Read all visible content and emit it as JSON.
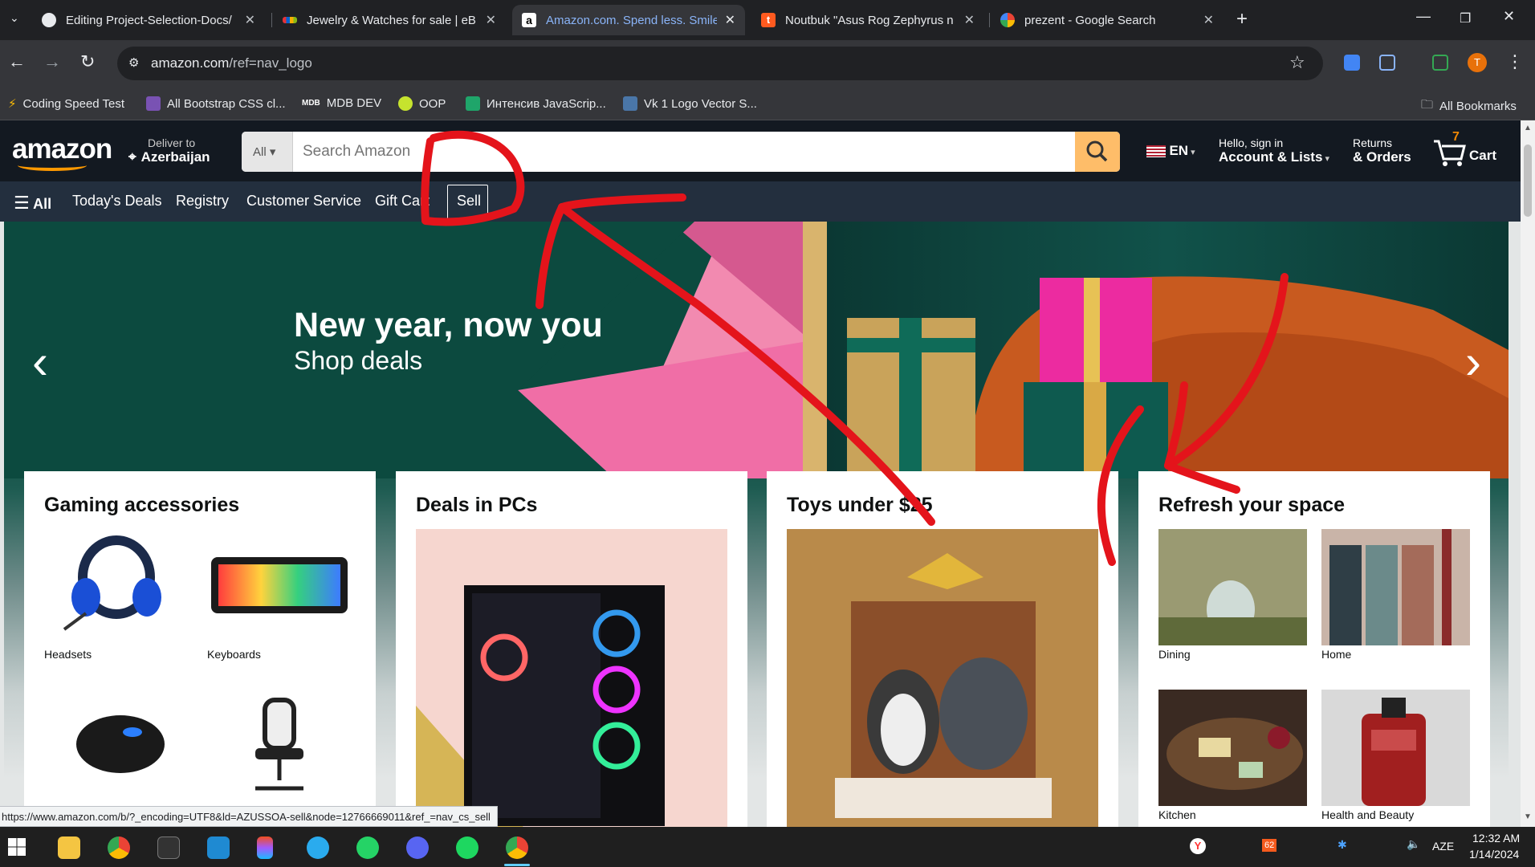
{
  "tabs": [
    {
      "title": "Editing Project-Selection-Docs/",
      "icon": "github-icon"
    },
    {
      "title": "Jewelry & Watches for sale | eB",
      "icon": "ebay-icon"
    },
    {
      "title": "Amazon.com. Spend less. Smile",
      "icon": "amazon-icon",
      "active": true
    },
    {
      "title": "Noutbuk \"Asus Rog Zephyrus n",
      "icon": "t-icon"
    },
    {
      "title": "prezent - Google Search",
      "icon": "google-icon"
    }
  ],
  "address": {
    "host": "amazon.com",
    "path": "/ref=nav_logo"
  },
  "profile_initial": "T",
  "bookmarks": [
    "Coding Speed Test",
    "All Bootstrap CSS cl...",
    "MDB DEV",
    "OOP",
    "Интенсив JavaScrip...",
    "Vk 1 Logo Vector S..."
  ],
  "all_bookmarks": "All Bookmarks",
  "amazon": {
    "logo": "amazon",
    "deliver_line1": "Deliver to",
    "deliver_line2": "Azerbaijan",
    "search_category": "All",
    "search_placeholder": "Search Amazon",
    "lang": "EN",
    "account_line1": "Hello, sign in",
    "account_line2": "Account & Lists",
    "returns_line1": "Returns",
    "returns_line2": "& Orders",
    "cart_count": "7",
    "cart_label": "Cart",
    "nav": [
      "All",
      "Today's Deals",
      "Registry",
      "Customer Service",
      "Gift Cards",
      "Sell"
    ]
  },
  "hero": {
    "headline": "New year, now you",
    "subline": "Shop deals"
  },
  "cards": [
    {
      "title": "Gaming accessories",
      "items": [
        "Headsets",
        "Keyboards",
        "",
        ""
      ]
    },
    {
      "title": "Deals in PCs"
    },
    {
      "title": "Toys under $25"
    },
    {
      "title": "Refresh your space",
      "items": [
        "Dining",
        "Home",
        "Kitchen",
        "Health and Beauty"
      ]
    }
  ],
  "status_url": "https://www.amazon.com/b/?_encoding=UTF8&ld=AZUSSOA-sell&node=12766669011&ref_=nav_cs_sell",
  "taskbar": {
    "lang": "AZE",
    "time": "12:32 AM",
    "date": "1/14/2024",
    "badge": "62"
  },
  "colors": {
    "amazon_dark": "#131921",
    "amazon_nav": "#232f3e",
    "amazon_orange": "#ff9900",
    "search_button": "#febd69",
    "annotation_red": "#e4141b"
  }
}
